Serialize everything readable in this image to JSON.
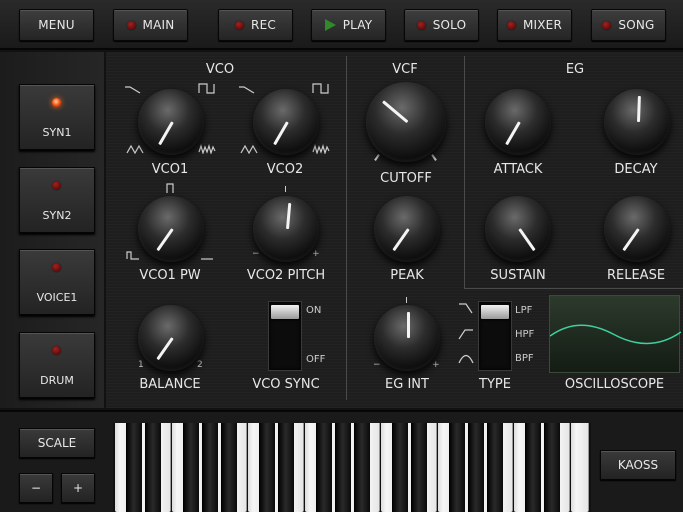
{
  "toolbar": {
    "menu": "MENU",
    "main": "MAIN",
    "rec": "REC",
    "play": "PLAY",
    "solo": "SOLO",
    "mixer": "MIXER",
    "song": "SONG"
  },
  "instruments": [
    {
      "label": "SYN1",
      "active": true
    },
    {
      "label": "SYN2",
      "active": false
    },
    {
      "label": "VOICE1",
      "active": false
    },
    {
      "label": "DRUM",
      "active": false
    }
  ],
  "sections": {
    "vco": "VCO",
    "vcf": "VCF",
    "eg": "EG"
  },
  "knobs": {
    "vco1": "VCO1",
    "vco2": "VCO2",
    "vco1_pw": "VCO1 PW",
    "vco2_pitch": "VCO2 PITCH",
    "balance": "BALANCE",
    "cutoff": "CUTOFF",
    "peak": "PEAK",
    "eg_int": "EG INT",
    "attack": "ATTACK",
    "decay": "DECAY",
    "sustain": "SUSTAIN",
    "release": "RELEASE"
  },
  "marks": {
    "minus": "−",
    "plus": "+",
    "one": "1",
    "two": "2"
  },
  "vco_sync": {
    "label": "VCO SYNC",
    "on": "ON",
    "off": "OFF"
  },
  "filter_type": {
    "label": "TYPE",
    "lpf": "LPF",
    "hpf": "HPF",
    "bpf": "BPF"
  },
  "oscilloscope": {
    "label": "OSCILLOSCOPE",
    "trace_color": "#3fd0a0"
  },
  "bottom": {
    "scale": "SCALE",
    "minus": "−",
    "plus": "+",
    "kaoss": "KAOSS"
  },
  "colors": {
    "led_on": "#ff5a1a",
    "led_off": "#8a1414",
    "play": "#2f8a2a"
  }
}
